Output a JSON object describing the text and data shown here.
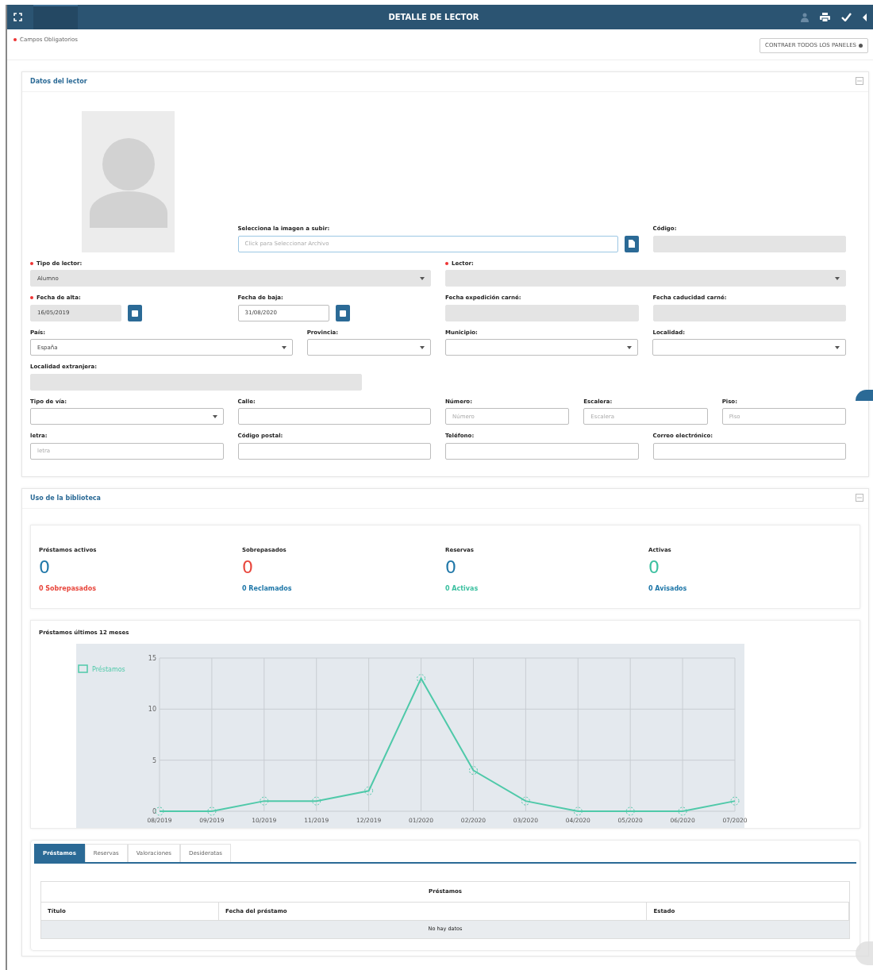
{
  "header": {
    "title": "DETALLE DE LECTOR"
  },
  "required_note": "Campos Obligatorios",
  "collapse_button": "CONTRAER TODOS LOS PANELES",
  "reader_panel": {
    "title": "Datos del lector",
    "upload_field": {
      "kind": "file",
      "label": "Selecciona la imagen a subir:",
      "placeholder": "Click para Seleccionar Archivo",
      "required": false,
      "disabled": false
    },
    "code_field": {
      "kind": "text",
      "label": "Código:",
      "required": false,
      "disabled": true
    },
    "fields": [
      {
        "kind": "select",
        "label": "Tipo de lector:",
        "value": "Alumno",
        "required": true,
        "disabled": true
      },
      {
        "kind": "select",
        "label": "Lector:",
        "required": true,
        "disabled": true
      },
      {
        "kind": "date",
        "label": "Fecha de alta:",
        "value": "16/05/2019",
        "required": true,
        "disabled": true
      },
      {
        "kind": "date",
        "label": "Fecha de baja:",
        "value": "31/08/2020",
        "required": false,
        "disabled": false
      },
      {
        "kind": "text",
        "label": "Fecha expedición carné:",
        "required": false,
        "disabled": true
      },
      {
        "kind": "text",
        "label": "Fecha caducidad carné:",
        "required": false,
        "disabled": true
      },
      {
        "kind": "select",
        "label": "País:",
        "value": "España",
        "required": false,
        "disabled": false
      },
      {
        "kind": "select",
        "label": "Provincia:",
        "required": false,
        "disabled": false
      },
      {
        "kind": "select",
        "label": "Municipio:",
        "required": false,
        "disabled": false
      },
      {
        "kind": "select",
        "label": "Localidad:",
        "required": false,
        "disabled": false
      },
      {
        "kind": "text",
        "label": "Localidad extranjera:",
        "required": false,
        "disabled": true
      },
      {
        "kind": "select",
        "label": "Tipo de vía:",
        "required": false,
        "disabled": false
      },
      {
        "kind": "text",
        "label": "Calle:",
        "required": false,
        "disabled": false
      },
      {
        "kind": "text",
        "label": "Número:",
        "placeholder": "Número",
        "required": false,
        "disabled": false
      },
      {
        "kind": "text",
        "label": "Escalera:",
        "placeholder": "Escalera",
        "required": false,
        "disabled": false
      },
      {
        "kind": "text",
        "label": "Piso:",
        "placeholder": "Piso",
        "required": false,
        "disabled": false
      },
      {
        "kind": "text",
        "label": "letra:",
        "placeholder": "letra",
        "required": false,
        "disabled": false
      },
      {
        "kind": "text",
        "label": "Código postal:",
        "required": false,
        "disabled": false
      },
      {
        "kind": "text",
        "label": "Teléfono:",
        "required": false,
        "disabled": false
      },
      {
        "kind": "text",
        "label": "Correo electrónico:",
        "required": false,
        "disabled": false
      }
    ]
  },
  "usage_panel": {
    "title": "Uso de la biblioteca",
    "stats": [
      {
        "label": "Préstamos activos",
        "value": "0",
        "color": "#1f77a8",
        "note": {
          "text": "0 Sobrepasados",
          "color": "#e8463c"
        }
      },
      {
        "label": "Sobrepasados",
        "value": "0",
        "color": "#e8463c",
        "note": {
          "text": "0 Reclamados",
          "color": "#1f77a8"
        }
      },
      {
        "label": "Reservas",
        "value": "0",
        "color": "#1f77a8",
        "note": {
          "text": "0 Activas",
          "color": "#3cc0a0"
        }
      },
      {
        "label": "Activas",
        "value": "0",
        "color": "#3cc0a0",
        "note": {
          "text": "0 Avisados",
          "color": "#1f77a8"
        }
      }
    ],
    "chart_title": "Préstamos últimos 12 meses",
    "chart_data": {
      "type": "line",
      "grid": true,
      "categories": [
        "08/2019",
        "09/2019",
        "10/2019",
        "11/2019",
        "12/2019",
        "01/2020",
        "02/2020",
        "03/2020",
        "04/2020",
        "05/2020",
        "06/2020",
        "07/2020"
      ],
      "series": [
        {
          "name": "Préstamos",
          "color": "#4fc9a9",
          "marker": "circle",
          "values": [
            0,
            0,
            1,
            1,
            2,
            13,
            4,
            1,
            0,
            0,
            0,
            1
          ]
        }
      ],
      "ylim": [
        0,
        15
      ],
      "yticks": [
        0,
        5,
        10,
        15
      ]
    },
    "tabs": [
      {
        "label": "Préstamos",
        "selected": true
      },
      {
        "label": "Reservas",
        "selected": false
      },
      {
        "label": "Valoraciones",
        "selected": false
      },
      {
        "label": "Desideratas",
        "selected": false
      }
    ],
    "table": {
      "caption": "Préstamos",
      "columns": [
        "Título",
        "Fecha del préstamo",
        "Estado"
      ],
      "empty_text": "No hay datos"
    }
  }
}
